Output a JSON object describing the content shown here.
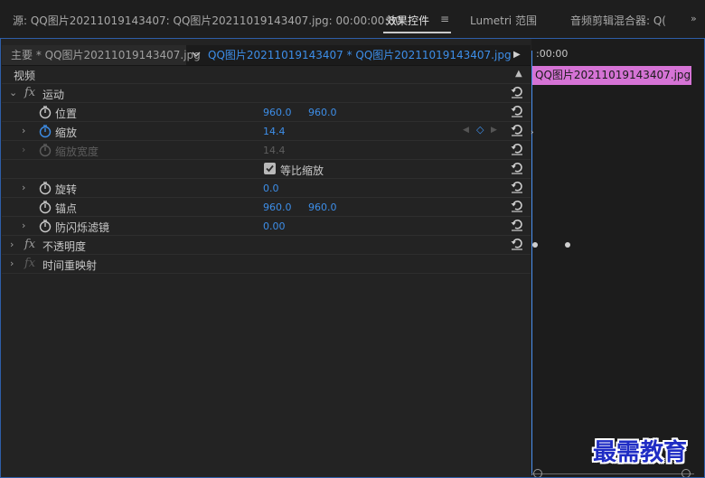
{
  "tabs": {
    "source": "源: QQ图片20211019143407: QQ图片20211019143407.jpg: 00:00:00:00",
    "effect_controls": "效果控件",
    "lumetri": "Lumetri 范围",
    "audio_mixer": "音频剪辑混合器: Q("
  },
  "clip_bar": {
    "master": "主要 * QQ图片20211019143407.jpg",
    "sequence": "QQ图片20211019143407  * QQ图片20211019143407.jpg"
  },
  "section": {
    "video": "视频"
  },
  "effects": {
    "motion": {
      "name": "运动",
      "position": {
        "label": "位置",
        "x": "960.0",
        "y": "960.0"
      },
      "scale": {
        "label": "缩放",
        "value": "14.4"
      },
      "scale_width": {
        "label": "缩放宽度",
        "value": "14.4"
      },
      "uniform_scale": {
        "label": "等比缩放"
      },
      "rotation": {
        "label": "旋转",
        "value": "0.0"
      },
      "anchor": {
        "label": "锚点",
        "x": "960.0",
        "y": "960.0"
      },
      "flicker": {
        "label": "防闪烁滤镜",
        "value": "0.00"
      }
    },
    "opacity": {
      "name": "不透明度"
    },
    "time_remap": {
      "name": "时间重映射"
    }
  },
  "timeline": {
    "timecode": ":00:00",
    "clip_name": "QQ图片20211019143407.jpg"
  },
  "watermark": "最需教育",
  "colors": {
    "accent_blue": "#3d8ee8",
    "clip_pink": "#d573d5",
    "frame_blue": "#2e5ea8"
  }
}
